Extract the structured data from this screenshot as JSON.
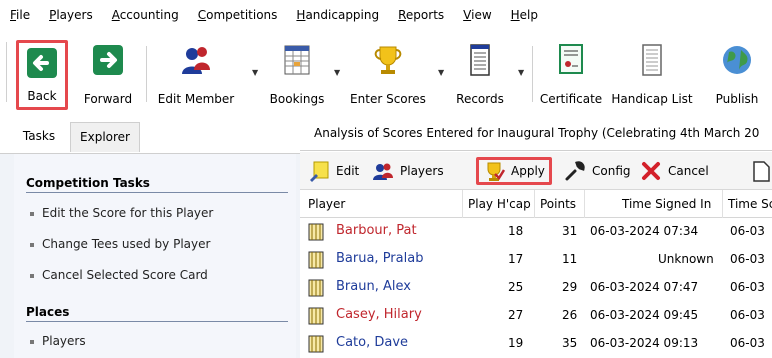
{
  "menu": [
    {
      "label": "File",
      "u": "F",
      "rest": "ile"
    },
    {
      "label": "Players",
      "u": "P",
      "rest": "layers"
    },
    {
      "label": "Accounting",
      "u": "A",
      "rest": "ccounting"
    },
    {
      "label": "Competitions",
      "u": "C",
      "rest": "ompetitions"
    },
    {
      "label": "Handicapping",
      "u": "H",
      "rest": "andicapping"
    },
    {
      "label": "Reports",
      "u": "R",
      "rest": "eports"
    },
    {
      "label": "View",
      "u": "V",
      "rest": "iew"
    },
    {
      "label": "Help",
      "u": "H",
      "rest": "elp"
    }
  ],
  "toolbar": {
    "back": "Back",
    "forward": "Forward",
    "edit_member": "Edit Member",
    "bookings": "Bookings",
    "enter_scores": "Enter Scores",
    "records": "Records",
    "certificate": "Certificate",
    "handicap_list": "Handicap List",
    "publish": "Publish"
  },
  "left": {
    "tabs": {
      "tasks": "Tasks",
      "explorer": "Explorer"
    },
    "competition_tasks_title": "Competition Tasks",
    "tasks": [
      "Edit the Score for this Player",
      "Change Tees used by Player",
      "Cancel Selected Score Card"
    ],
    "places_title": "Places",
    "places": [
      "Players"
    ]
  },
  "analysis_title": "Analysis of Scores Entered for Inaugural Trophy (Celebrating 4th March 20",
  "subtoolbar": {
    "edit": "Edit",
    "players": "Players",
    "apply": "Apply",
    "config": "Config",
    "cancel": "Cancel"
  },
  "grid": {
    "headers": {
      "player": "Player",
      "play_hcap": "Play H'cap",
      "points": "Points",
      "time_signed_in": "Time Signed In",
      "time_sc": "Time Sc"
    },
    "rows": [
      {
        "name": "Barbour, Pat",
        "hcap": "18",
        "points": "31",
        "signed": "06-03-2024  07:34",
        "timesc": "06-03",
        "color": "#c0262d"
      },
      {
        "name": "Barua, Pralab",
        "hcap": "17",
        "points": "11",
        "signed": "Unknown",
        "timesc": "06-03",
        "color": "#1f3c9a"
      },
      {
        "name": "Braun, Alex",
        "hcap": "25",
        "points": "29",
        "signed": "06-03-2024  07:47",
        "timesc": "06-03",
        "color": "#1f3c9a"
      },
      {
        "name": "Casey, Hilary",
        "hcap": "27",
        "points": "26",
        "signed": "06-03-2024  09:45",
        "timesc": "06-03",
        "color": "#c0262d"
      },
      {
        "name": "Cato, Dave",
        "hcap": "19",
        "points": "35",
        "signed": "06-03-2024  09:13",
        "timesc": "06-03",
        "color": "#1f3c9a"
      }
    ]
  },
  "colors": {
    "highlight": "#e5484d",
    "accent_green": "#1e8a4e",
    "female": "#c0262d",
    "male": "#1f3c9a"
  }
}
